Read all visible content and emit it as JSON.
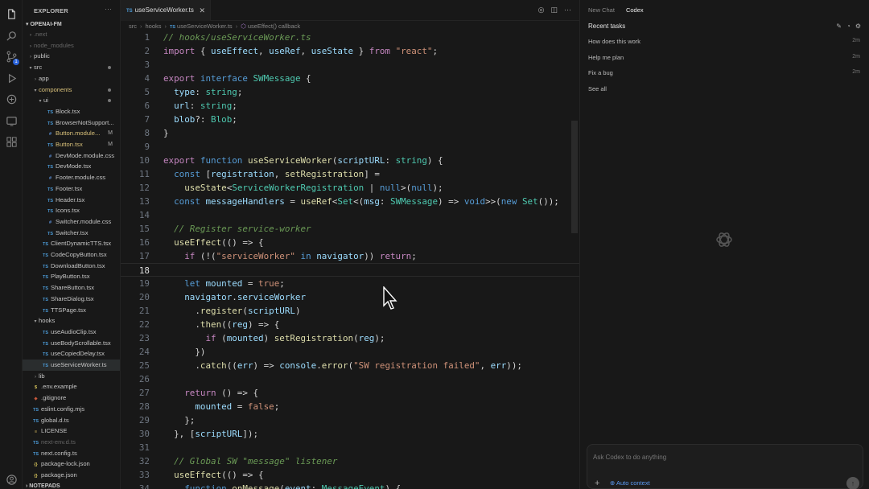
{
  "activity_bar": {
    "icons": [
      "files-icon",
      "search-icon",
      "source-control-icon",
      "run-debug-icon",
      "extensions-icon",
      "remote-explorer-icon",
      "accounts-icon"
    ],
    "scm_badge": "1"
  },
  "explorer": {
    "header": "EXPLORER",
    "more": "···",
    "project": "OPENAI-FM",
    "bottom_section": "NOTEPADS",
    "items": [
      {
        "label": ".next",
        "kind": "folder",
        "depth": 1,
        "open": false,
        "dim": true
      },
      {
        "label": "node_modules",
        "kind": "folder",
        "depth": 1,
        "open": false,
        "dim": true
      },
      {
        "label": "public",
        "kind": "folder",
        "depth": 1,
        "open": false
      },
      {
        "label": "src",
        "kind": "folder",
        "depth": 1,
        "open": true,
        "dot": true
      },
      {
        "label": "app",
        "kind": "folder",
        "depth": 2,
        "open": false
      },
      {
        "label": "components",
        "kind": "folder",
        "depth": 2,
        "open": true,
        "dot": true,
        "mod": true
      },
      {
        "label": "ui",
        "kind": "folder",
        "depth": 3,
        "open": true,
        "dot": true
      },
      {
        "label": "Block.tsx",
        "kind": "tsx",
        "depth": 4
      },
      {
        "label": "BrowserNotSupport...",
        "kind": "tsx",
        "depth": 4
      },
      {
        "label": "Button.module...",
        "kind": "css",
        "depth": 4,
        "mark": "M",
        "mod": true
      },
      {
        "label": "Button.tsx",
        "kind": "tsx",
        "depth": 4,
        "mark": "M",
        "mod": true
      },
      {
        "label": "DevMode.module.css",
        "kind": "css",
        "depth": 4
      },
      {
        "label": "DevMode.tsx",
        "kind": "tsx",
        "depth": 4
      },
      {
        "label": "Footer.module.css",
        "kind": "css",
        "depth": 4
      },
      {
        "label": "Footer.tsx",
        "kind": "tsx",
        "depth": 4
      },
      {
        "label": "Header.tsx",
        "kind": "tsx",
        "depth": 4
      },
      {
        "label": "Icons.tsx",
        "kind": "tsx",
        "depth": 4
      },
      {
        "label": "Switcher.module.css",
        "kind": "css",
        "depth": 4
      },
      {
        "label": "Switcher.tsx",
        "kind": "tsx",
        "depth": 4
      },
      {
        "label": "ClientDynamicTTS.tsx",
        "kind": "tsx",
        "depth": 3
      },
      {
        "label": "CodeCopyButton.tsx",
        "kind": "tsx",
        "depth": 3
      },
      {
        "label": "DownloadButton.tsx",
        "kind": "tsx",
        "depth": 3
      },
      {
        "label": "PlayButton.tsx",
        "kind": "tsx",
        "depth": 3
      },
      {
        "label": "ShareButton.tsx",
        "kind": "tsx",
        "depth": 3
      },
      {
        "label": "ShareDialog.tsx",
        "kind": "tsx",
        "depth": 3
      },
      {
        "label": "TTSPage.tsx",
        "kind": "tsx",
        "depth": 3
      },
      {
        "label": "hooks",
        "kind": "folder",
        "depth": 2,
        "open": true
      },
      {
        "label": "useAudioClip.tsx",
        "kind": "ts",
        "depth": 3
      },
      {
        "label": "useBodyScrollable.tsx",
        "kind": "ts",
        "depth": 3
      },
      {
        "label": "useCopiedDelay.tsx",
        "kind": "ts",
        "depth": 3
      },
      {
        "label": "useServiceWorker.ts",
        "kind": "ts",
        "depth": 3,
        "selected": true
      },
      {
        "label": "lib",
        "kind": "folder",
        "depth": 2,
        "open": false
      },
      {
        "label": ".env.example",
        "kind": "env",
        "depth": 1
      },
      {
        "label": ".gitignore",
        "kind": "git",
        "depth": 1
      },
      {
        "label": "eslint.config.mjs",
        "kind": "ts",
        "depth": 1
      },
      {
        "label": "global.d.ts",
        "kind": "ts",
        "depth": 1
      },
      {
        "label": "LICENSE",
        "kind": "license",
        "depth": 1
      },
      {
        "label": "next-env.d.ts",
        "kind": "ts",
        "depth": 1,
        "dim": true
      },
      {
        "label": "next.config.ts",
        "kind": "ts",
        "depth": 1
      },
      {
        "label": "package-lock.json",
        "kind": "json",
        "depth": 1
      },
      {
        "label": "package.json",
        "kind": "json",
        "depth": 1
      }
    ]
  },
  "editor": {
    "tab_label": "useServiceWorker.ts",
    "tab_badge": "TS",
    "breadcrumb": [
      "src",
      "hooks",
      "useServiceWorker.ts",
      "useEffect() callback"
    ],
    "current_line": 18,
    "lines": [
      {
        "n": "1",
        "t": [
          [
            "cm",
            "// hooks/useServiceWorker.ts"
          ]
        ]
      },
      {
        "n": "2",
        "t": [
          [
            "ctl",
            "import"
          ],
          [
            "pn",
            " { "
          ],
          [
            "vr",
            "useEffect"
          ],
          [
            "pn",
            ", "
          ],
          [
            "vr",
            "useRef"
          ],
          [
            "pn",
            ", "
          ],
          [
            "vr",
            "useState"
          ],
          [
            "pn",
            " } "
          ],
          [
            "ctl",
            "from"
          ],
          [
            "pn",
            " "
          ],
          [
            "st",
            "\"react\""
          ],
          [
            "pn",
            ";"
          ]
        ]
      },
      {
        "n": "3",
        "t": []
      },
      {
        "n": "4",
        "t": [
          [
            "ctl",
            "export"
          ],
          [
            "pn",
            " "
          ],
          [
            "kw",
            "interface"
          ],
          [
            "pn",
            " "
          ],
          [
            "ty",
            "SWMessage"
          ],
          [
            "pn",
            " {"
          ]
        ]
      },
      {
        "n": "5",
        "t": [
          [
            "pn",
            "  "
          ],
          [
            "vr",
            "type"
          ],
          [
            "pn",
            ": "
          ],
          [
            "ty",
            "string"
          ],
          [
            "pn",
            ";"
          ]
        ]
      },
      {
        "n": "6",
        "t": [
          [
            "pn",
            "  "
          ],
          [
            "vr",
            "url"
          ],
          [
            "pn",
            ": "
          ],
          [
            "ty",
            "string"
          ],
          [
            "pn",
            ";"
          ]
        ]
      },
      {
        "n": "7",
        "t": [
          [
            "pn",
            "  "
          ],
          [
            "vr",
            "blob"
          ],
          [
            "pn",
            "?: "
          ],
          [
            "ty",
            "Blob"
          ],
          [
            "pn",
            ";"
          ]
        ]
      },
      {
        "n": "8",
        "t": [
          [
            "pn",
            "}"
          ]
        ]
      },
      {
        "n": "9",
        "t": []
      },
      {
        "n": "10",
        "t": [
          [
            "ctl",
            "export"
          ],
          [
            "pn",
            " "
          ],
          [
            "kw",
            "function"
          ],
          [
            "pn",
            " "
          ],
          [
            "fn",
            "useServiceWorker"
          ],
          [
            "pn",
            "("
          ],
          [
            "vr",
            "scriptURL"
          ],
          [
            "pn",
            ": "
          ],
          [
            "ty",
            "string"
          ],
          [
            "pn",
            ") {"
          ]
        ]
      },
      {
        "n": "11",
        "t": [
          [
            "pn",
            "  "
          ],
          [
            "kw",
            "const"
          ],
          [
            "pn",
            " ["
          ],
          [
            "vr",
            "registration"
          ],
          [
            "pn",
            ", "
          ],
          [
            "fn",
            "setRegistration"
          ],
          [
            "pn",
            "] ="
          ]
        ]
      },
      {
        "n": "12",
        "t": [
          [
            "pn",
            "    "
          ],
          [
            "fn",
            "useState"
          ],
          [
            "pn",
            "<"
          ],
          [
            "ty",
            "ServiceWorkerRegistration"
          ],
          [
            "pn",
            " | "
          ],
          [
            "kw",
            "null"
          ],
          [
            "pn",
            ">("
          ],
          [
            "kw",
            "null"
          ],
          [
            "pn",
            ");"
          ]
        ]
      },
      {
        "n": "13",
        "t": [
          [
            "pn",
            "  "
          ],
          [
            "kw",
            "const"
          ],
          [
            "pn",
            " "
          ],
          [
            "vr",
            "messageHandlers"
          ],
          [
            "pn",
            " = "
          ],
          [
            "fn",
            "useRef"
          ],
          [
            "pn",
            "<"
          ],
          [
            "ty",
            "Set"
          ],
          [
            "pn",
            "<("
          ],
          [
            "vr",
            "msg"
          ],
          [
            "pn",
            ": "
          ],
          [
            "ty",
            "SWMessage"
          ],
          [
            "pn",
            ") => "
          ],
          [
            "kw",
            "void"
          ],
          [
            "pn",
            ">>("
          ],
          [
            "kw",
            "new"
          ],
          [
            "pn",
            " "
          ],
          [
            "ty",
            "Set"
          ],
          [
            "pn",
            "());"
          ]
        ]
      },
      {
        "n": "14",
        "t": []
      },
      {
        "n": "15",
        "t": [
          [
            "pn",
            "  "
          ],
          [
            "cm",
            "// Register service-worker"
          ]
        ]
      },
      {
        "n": "16",
        "t": [
          [
            "pn",
            "  "
          ],
          [
            "fn",
            "useEffect"
          ],
          [
            "pn",
            "(() => {"
          ]
        ]
      },
      {
        "n": "17",
        "t": [
          [
            "pn",
            "    "
          ],
          [
            "ctl",
            "if"
          ],
          [
            "pn",
            " (!("
          ],
          [
            "st",
            "\"serviceWorker\""
          ],
          [
            "pn",
            " "
          ],
          [
            "kw",
            "in"
          ],
          [
            "pn",
            " "
          ],
          [
            "vr",
            "navigator"
          ],
          [
            "pn",
            ")) "
          ],
          [
            "ctl",
            "return"
          ],
          [
            "pn",
            ";"
          ]
        ]
      },
      {
        "n": "18",
        "t": []
      },
      {
        "n": "19",
        "t": [
          [
            "pn",
            "    "
          ],
          [
            "kw",
            "let"
          ],
          [
            "pn",
            " "
          ],
          [
            "vr",
            "mounted"
          ],
          [
            "pn",
            " = "
          ],
          [
            "st",
            "true"
          ],
          [
            "pn",
            ";"
          ]
        ]
      },
      {
        "n": "20",
        "t": [
          [
            "pn",
            "    "
          ],
          [
            "vr",
            "navigator"
          ],
          [
            "pn",
            "."
          ],
          [
            "vr",
            "serviceWorker"
          ]
        ]
      },
      {
        "n": "21",
        "t": [
          [
            "pn",
            "      ."
          ],
          [
            "fn",
            "register"
          ],
          [
            "pn",
            "("
          ],
          [
            "vr",
            "scriptURL"
          ],
          [
            "pn",
            ")"
          ]
        ]
      },
      {
        "n": "22",
        "t": [
          [
            "pn",
            "      ."
          ],
          [
            "fn",
            "then"
          ],
          [
            "pn",
            "(("
          ],
          [
            "vr",
            "reg"
          ],
          [
            "pn",
            ") => {"
          ]
        ]
      },
      {
        "n": "23",
        "t": [
          [
            "pn",
            "        "
          ],
          [
            "ctl",
            "if"
          ],
          [
            "pn",
            " ("
          ],
          [
            "vr",
            "mounted"
          ],
          [
            "pn",
            ") "
          ],
          [
            "fn",
            "setRegistration"
          ],
          [
            "pn",
            "("
          ],
          [
            "vr",
            "reg"
          ],
          [
            "pn",
            ");"
          ]
        ]
      },
      {
        "n": "24",
        "t": [
          [
            "pn",
            "      })"
          ]
        ]
      },
      {
        "n": "25",
        "t": [
          [
            "pn",
            "      ."
          ],
          [
            "fn",
            "catch"
          ],
          [
            "pn",
            "(("
          ],
          [
            "vr",
            "err"
          ],
          [
            "pn",
            ") => "
          ],
          [
            "vr",
            "console"
          ],
          [
            "pn",
            "."
          ],
          [
            "fn",
            "error"
          ],
          [
            "pn",
            "("
          ],
          [
            "st",
            "\"SW registration failed\""
          ],
          [
            "pn",
            ", "
          ],
          [
            "vr",
            "err"
          ],
          [
            "pn",
            "));"
          ]
        ]
      },
      {
        "n": "26",
        "t": []
      },
      {
        "n": "27",
        "t": [
          [
            "pn",
            "    "
          ],
          [
            "ctl",
            "return"
          ],
          [
            "pn",
            " () => {"
          ]
        ]
      },
      {
        "n": "28",
        "t": [
          [
            "pn",
            "      "
          ],
          [
            "vr",
            "mounted"
          ],
          [
            "pn",
            " = "
          ],
          [
            "st",
            "false"
          ],
          [
            "pn",
            ";"
          ]
        ]
      },
      {
        "n": "29",
        "t": [
          [
            "pn",
            "    };"
          ]
        ]
      },
      {
        "n": "30",
        "t": [
          [
            "pn",
            "  }, ["
          ],
          [
            "vr",
            "scriptURL"
          ],
          [
            "pn",
            "]);"
          ]
        ]
      },
      {
        "n": "31",
        "t": []
      },
      {
        "n": "32",
        "t": [
          [
            "pn",
            "  "
          ],
          [
            "cm",
            "// Global SW \"message\" listener"
          ]
        ]
      },
      {
        "n": "33",
        "t": [
          [
            "pn",
            "  "
          ],
          [
            "fn",
            "useEffect"
          ],
          [
            "pn",
            "(() => {"
          ]
        ]
      },
      {
        "n": "34",
        "t": [
          [
            "pn",
            "    "
          ],
          [
            "kw",
            "function"
          ],
          [
            "pn",
            " "
          ],
          [
            "fn",
            "onMessage"
          ],
          [
            "pn",
            "("
          ],
          [
            "vr",
            "event"
          ],
          [
            "pn",
            ": "
          ],
          [
            "ty",
            "MessageEvent"
          ],
          [
            "pn",
            ") {"
          ]
        ]
      }
    ]
  },
  "panel": {
    "tabs": [
      {
        "label": "New Chat",
        "active": false
      },
      {
        "label": "Codex",
        "active": true
      }
    ],
    "title": "Recent tasks",
    "tasks": [
      {
        "label": "How does this work",
        "age": "2m"
      },
      {
        "label": "Help me plan",
        "age": "2m"
      },
      {
        "label": "Fix a bug",
        "age": "2m"
      }
    ],
    "see_all": "See all",
    "composer_placeholder": "Ask Codex to do anything",
    "plus": "+",
    "auto_context": "Auto context",
    "send": "↑"
  },
  "colors": {
    "background": "#181818",
    "comment": "#6a9955",
    "keyword": "#569cd6",
    "type": "#4ec9b0",
    "function": "#dcdcaa",
    "string": "#ce9178",
    "variable": "#9cdcfe",
    "control": "#c586c0",
    "modified": "#d9c17a",
    "link": "#5b9bf5"
  }
}
